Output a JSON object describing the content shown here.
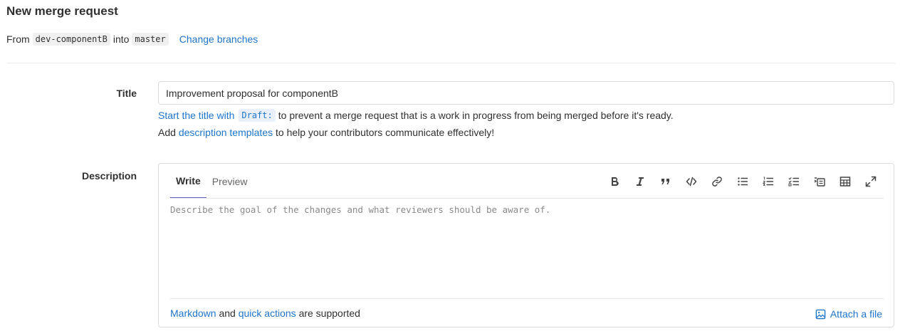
{
  "header": {
    "title": "New merge request"
  },
  "branches": {
    "from_label": "From",
    "source": "dev-componentB",
    "into_label": "into",
    "target": "master",
    "change_link": "Change branches"
  },
  "form": {
    "title_label": "Title",
    "title_value": "Improvement proposal for componentB",
    "draft_hint_link": "Start the title with",
    "draft_code": "Draft:",
    "draft_hint_rest": "to prevent a merge request that is a work in progress from being merged before it's ready.",
    "templates_prefix": "Add",
    "templates_link": "description templates",
    "templates_suffix": "to help your contributors communicate effectively!",
    "description_label": "Description"
  },
  "editor": {
    "tabs": [
      {
        "label": "Write",
        "active": true
      },
      {
        "label": "Preview",
        "active": false
      }
    ],
    "toolbar": [
      {
        "icon": "bold-icon"
      },
      {
        "icon": "italic-icon"
      },
      {
        "icon": "quote-icon"
      },
      {
        "icon": "code-icon"
      },
      {
        "icon": "link-icon"
      },
      {
        "icon": "bullet-list-icon"
      },
      {
        "icon": "numbered-list-icon"
      },
      {
        "icon": "task-list-icon"
      },
      {
        "icon": "collapsible-section-icon"
      },
      {
        "icon": "table-icon"
      },
      {
        "icon": "fullscreen-icon"
      }
    ],
    "placeholder": "Describe the goal of the changes and what reviewers should be aware of.",
    "footer_markdown_link": "Markdown",
    "footer_and": "and",
    "footer_quick_actions_link": "quick actions",
    "footer_supported": "are supported",
    "attach_label": "Attach a file"
  },
  "colors": {
    "link": "#1f75cb",
    "active_tab_underline": "#6666c4",
    "border": "#dbdbdb"
  }
}
